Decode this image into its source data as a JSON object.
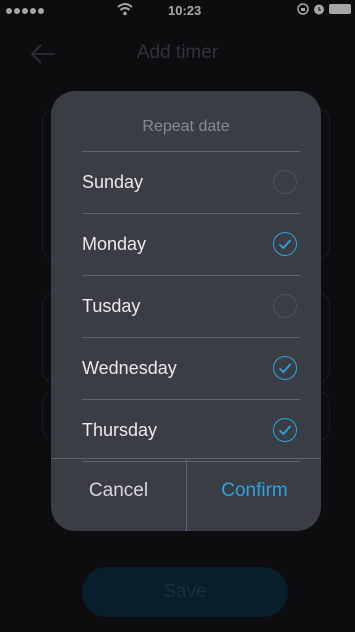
{
  "status_bar": {
    "time": "10:23",
    "signal_icon": "signal-dots-icon",
    "wifi_icon": "wifi-icon",
    "rotation_lock_icon": "rotation-lock-icon",
    "alarm_icon": "alarm-icon",
    "battery_icon": "battery-icon"
  },
  "nav": {
    "title": "Add timer",
    "back_icon": "back-arrow-icon"
  },
  "dialog": {
    "title": "Repeat date",
    "days": [
      {
        "label": "Sunday",
        "checked": false
      },
      {
        "label": "Monday",
        "checked": true
      },
      {
        "label": "Tusday",
        "checked": false
      },
      {
        "label": "Wednesday",
        "checked": true
      },
      {
        "label": "Thursday",
        "checked": true
      }
    ],
    "cancel_label": "Cancel",
    "confirm_label": "Confirm"
  },
  "save_label": "Save",
  "colors": {
    "accent": "#2aa4e3",
    "dialog_bg": "#3a3d44",
    "screen_bg": "#141519"
  }
}
